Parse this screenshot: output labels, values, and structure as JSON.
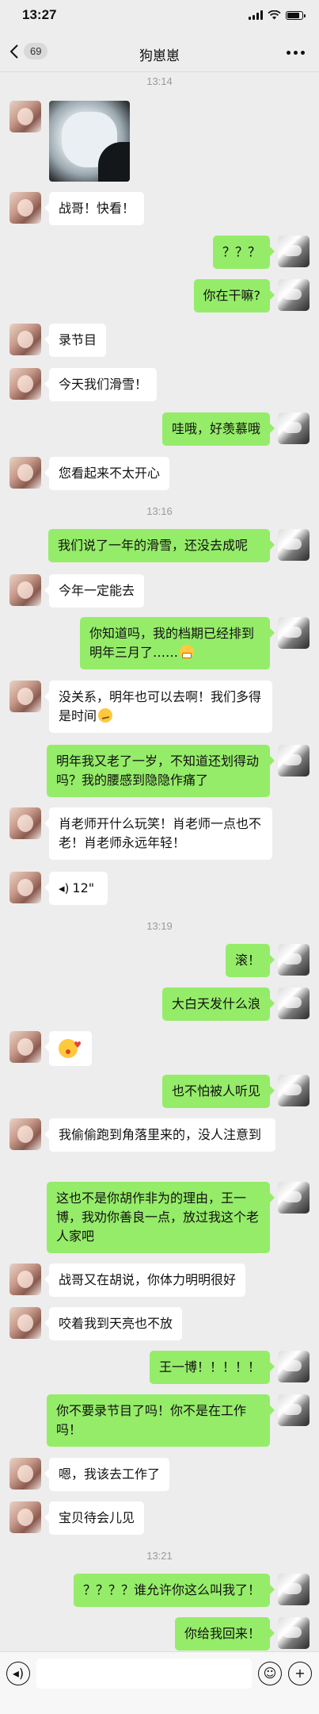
{
  "status": {
    "time": "13:27"
  },
  "nav": {
    "back_badge": "69",
    "title": "狗崽崽"
  },
  "chat": {
    "timestamps": [
      "13:14",
      "13:16",
      "13:19",
      "13:21"
    ],
    "messages": [
      {
        "side": "left",
        "type": "image"
      },
      {
        "side": "left",
        "text": "战哥！快看！"
      },
      {
        "side": "right",
        "text": "？？？"
      },
      {
        "side": "right",
        "text": "你在干嘛?"
      },
      {
        "side": "left",
        "text": "录节目"
      },
      {
        "side": "left",
        "text": "今天我们滑雪！"
      },
      {
        "side": "right",
        "text": "哇哦，好羡慕哦"
      },
      {
        "side": "left",
        "text": "您看起来不太开心"
      },
      {
        "side": "right",
        "text": "我们说了一年的滑雪，还没去成呢"
      },
      {
        "side": "left",
        "text": "今年一定能去"
      },
      {
        "side": "right",
        "text": "你知道吗，我的档期已经排到明年三月了……",
        "emoji": "grimace"
      },
      {
        "side": "left",
        "text": "没关系，明年也可以去啊！我们多得是时间",
        "emoji": "smirk"
      },
      {
        "side": "right",
        "text": "明年我又老了一岁，不知道还划得动吗？我的腰感到隐隐作痛了"
      },
      {
        "side": "left",
        "text": "肖老师开什么玩笑！肖老师一点也不老！肖老师永远年轻！"
      },
      {
        "side": "left",
        "type": "voice",
        "text": "12\""
      },
      {
        "side": "right",
        "text": "滚！"
      },
      {
        "side": "right",
        "text": "大白天发什么浪"
      },
      {
        "side": "left",
        "type": "emoji",
        "emoji": "kiss"
      },
      {
        "side": "right",
        "text": "也不怕被人听见"
      },
      {
        "side": "left",
        "text": "我偷偷跑到角落里来的，没人注意到"
      },
      {
        "side": "right",
        "text": "这也不是你胡作非为的理由，王一博，我劝你善良一点，放过我这个老人家吧"
      },
      {
        "side": "left",
        "text": "战哥又在胡说，你体力明明很好"
      },
      {
        "side": "left",
        "text": "咬着我到天亮也不放"
      },
      {
        "side": "right",
        "text": "王一博！！！！！"
      },
      {
        "side": "right",
        "text": "你不要录节目了吗！你不是在工作吗！"
      },
      {
        "side": "left",
        "text": "嗯，我该去工作了"
      },
      {
        "side": "left",
        "text": "宝贝待会儿见"
      },
      {
        "side": "right",
        "text": "？？？？谁允许你这么叫我了！"
      },
      {
        "side": "right",
        "text": "你给我回来！"
      }
    ]
  },
  "input": {
    "value": "",
    "placeholder": ""
  },
  "icons": {
    "back": "chevron-left-icon",
    "more": "more-dots-icon",
    "voice_toggle": "voice-icon",
    "emoji_button": "smiley-icon",
    "add_button": "plus-icon"
  },
  "colors": {
    "background": "#ededed",
    "sent_bubble": "#95ec69",
    "received_bubble": "#ffffff",
    "timestamp": "#9a9a9a"
  }
}
